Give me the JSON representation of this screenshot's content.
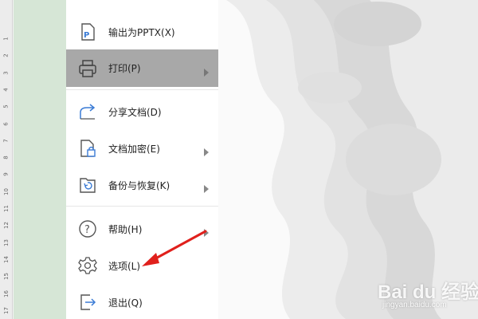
{
  "ruler": {
    "numbers": [
      "1",
      "2",
      "3",
      "4",
      "5",
      "6",
      "7",
      "8",
      "9",
      "10",
      "11",
      "12",
      "13",
      "14",
      "15",
      "16",
      "17",
      "18"
    ]
  },
  "menu": {
    "items": [
      {
        "id": "export-pptx",
        "label": "输出为PPTX(X)",
        "icon": "export-pptx-icon",
        "has_submenu": false,
        "active": false
      },
      {
        "id": "print",
        "label": "打印(P)",
        "icon": "printer-icon",
        "has_submenu": true,
        "active": true
      },
      {
        "id": "share",
        "label": "分享文档(D)",
        "icon": "share-icon",
        "has_submenu": false,
        "active": false
      },
      {
        "id": "encrypt",
        "label": "文档加密(E)",
        "icon": "document-lock-icon",
        "has_submenu": true,
        "active": false
      },
      {
        "id": "backup",
        "label": "备份与恢复(K)",
        "icon": "backup-restore-icon",
        "has_submenu": true,
        "active": false
      },
      {
        "id": "help",
        "label": "帮助(H)",
        "icon": "help-icon",
        "has_submenu": true,
        "active": false
      },
      {
        "id": "options",
        "label": "选项(L)",
        "icon": "gear-icon",
        "has_submenu": false,
        "active": false
      },
      {
        "id": "exit",
        "label": "退出(Q)",
        "icon": "exit-icon",
        "has_submenu": false,
        "active": false
      }
    ]
  },
  "colors": {
    "active_item": "#a8a8a8",
    "annotation_arrow": "#e0201c",
    "green_strip": "#d6e6d6",
    "icon_blue": "#3a7bd5"
  },
  "watermark": {
    "main": "Bai du 经验",
    "sub": "jingyan.baidu.com"
  }
}
